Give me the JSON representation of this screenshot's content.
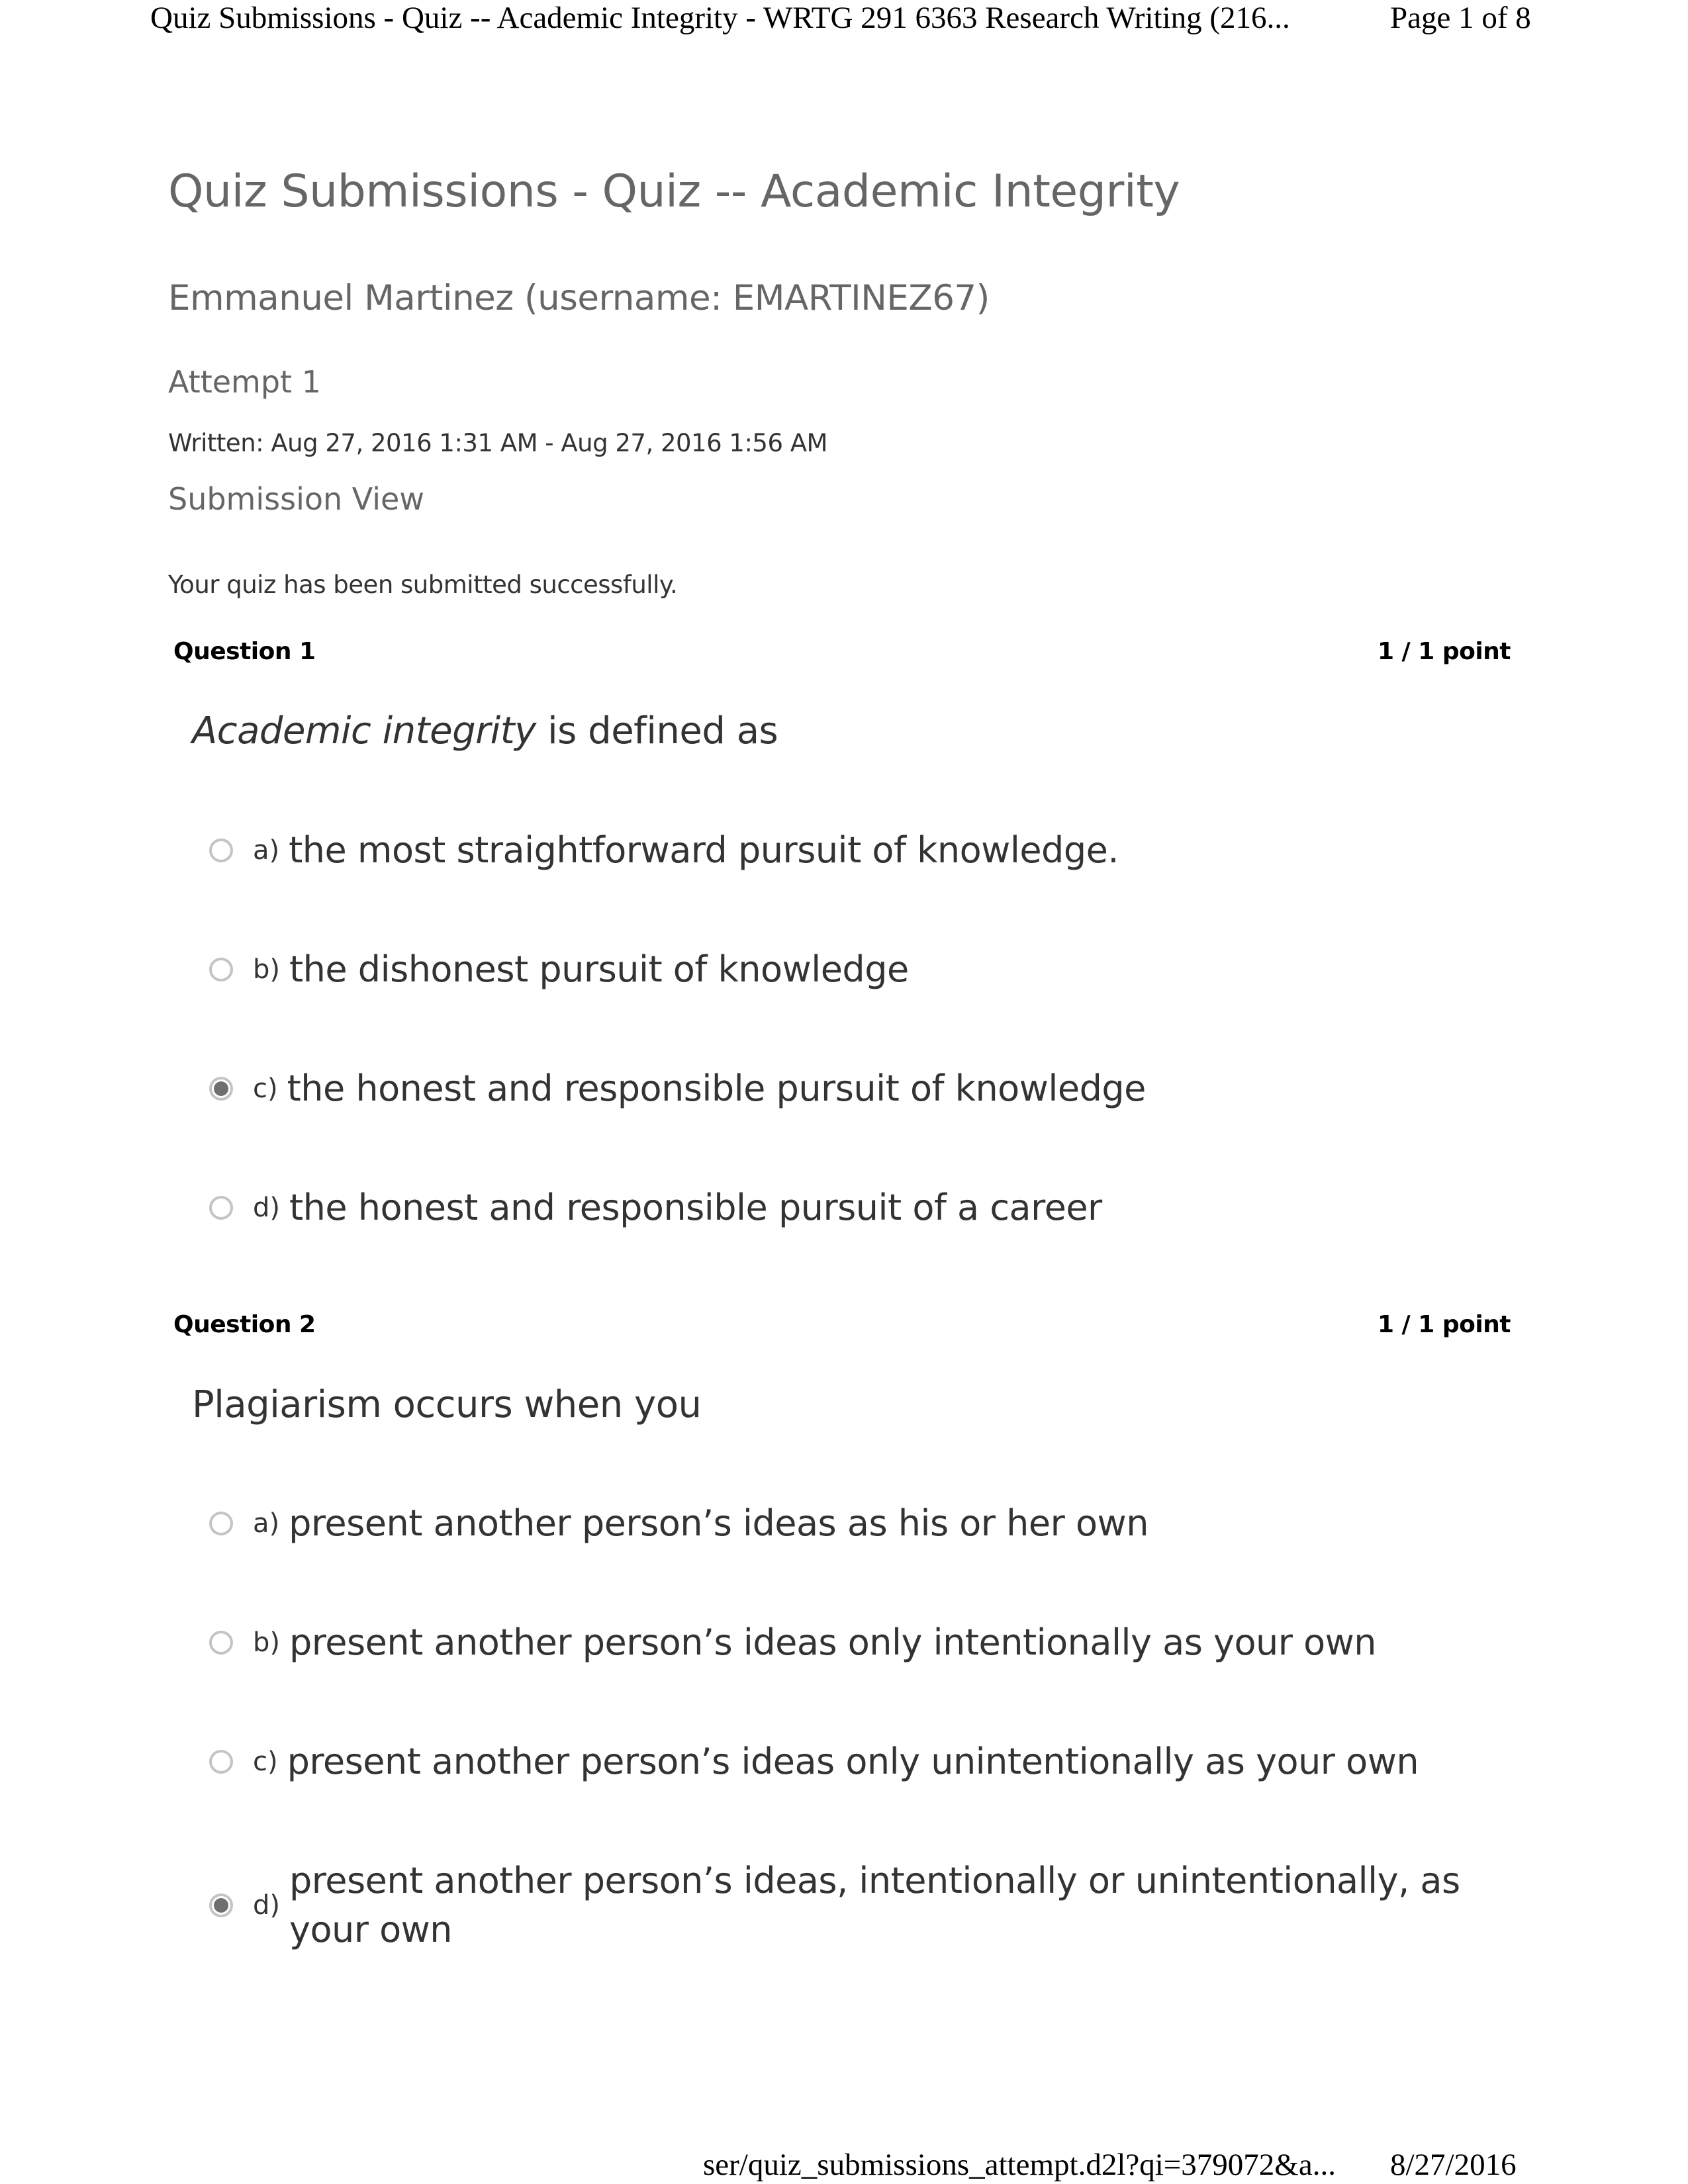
{
  "print_header": {
    "title": "Quiz Submissions - Quiz -- Academic Integrity - WRTG 291 6363 Research Writing (216...",
    "page": "Page 1 of 8"
  },
  "print_footer": {
    "url": "ser/quiz_submissions_attempt.d2l?qi=379072&a...",
    "date": "8/27/2016"
  },
  "page": {
    "title": "Quiz Submissions - Quiz -- Academic Integrity",
    "user": "Emmanuel Martinez (username: EMARTINEZ67)",
    "attempt": "Attempt 1",
    "written": "Written: Aug 27, 2016 1:31 AM - Aug 27, 2016 1:56 AM",
    "view_label": "Submission View",
    "status_message": "Your quiz has been submitted successfully."
  },
  "questions": [
    {
      "label": "Question 1",
      "points": "1 / 1 point",
      "prompt_emphasis": "Academic integrity",
      "prompt_rest": " is defined as",
      "options": [
        {
          "letter": "a)",
          "text": "the most straightforward pursuit of knowledge.",
          "selected": false
        },
        {
          "letter": "b)",
          "text": "the dishonest pursuit of knowledge",
          "selected": false
        },
        {
          "letter": "c)",
          "text": "the honest and responsible pursuit of knowledge",
          "selected": true
        },
        {
          "letter": "d)",
          "text": "the honest and responsible pursuit of a career",
          "selected": false
        }
      ]
    },
    {
      "label": "Question 2",
      "points": "1 / 1 point",
      "prompt": "Plagiarism occurs when you",
      "options": [
        {
          "letter": "a)",
          "text": "present another person’s ideas as his or her own",
          "selected": false
        },
        {
          "letter": "b)",
          "text": "present another person’s ideas only intentionally as your own",
          "selected": false
        },
        {
          "letter": "c)",
          "text": "present another person’s ideas only unintentionally as your own",
          "selected": false
        },
        {
          "letter": "d)",
          "text": "present another person’s ideas, intentionally or unintentionally, as your own",
          "selected": true
        }
      ]
    }
  ],
  "colors": {
    "heading_gray": "#666666",
    "body_text": "#333333",
    "radio_border": "#c4c4c4",
    "radio_fill": "#6f6f6f"
  }
}
